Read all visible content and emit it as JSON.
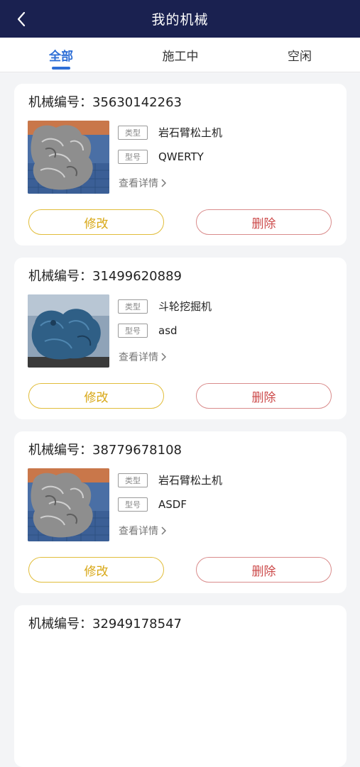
{
  "nav": {
    "title": "我的机械",
    "back_icon": "chevron-left-icon"
  },
  "tabs": [
    {
      "label": "全部",
      "active": true
    },
    {
      "label": "施工中",
      "active": false
    },
    {
      "label": "空闲",
      "active": false
    }
  ],
  "labels": {
    "serial_prefix": "机械编号：",
    "type_tag": "类型",
    "model_tag": "型号",
    "details": "查看详情",
    "edit": "修改",
    "delete": "删除"
  },
  "machines": [
    {
      "serial": "35630142263",
      "type": "岩石臂松土机",
      "model": "QWERTY"
    },
    {
      "serial": "31499620889",
      "type": "斗轮挖掘机",
      "model": "asd"
    },
    {
      "serial": "38779678108",
      "type": "岩石臂松土机",
      "model": "ASDF"
    },
    {
      "serial": "32949178547",
      "type": "",
      "model": ""
    }
  ],
  "colors": {
    "nav_bg": "#1a2150",
    "accent": "#2f6fd6",
    "edit": "#d8a714",
    "delete": "#cc4a4a"
  }
}
